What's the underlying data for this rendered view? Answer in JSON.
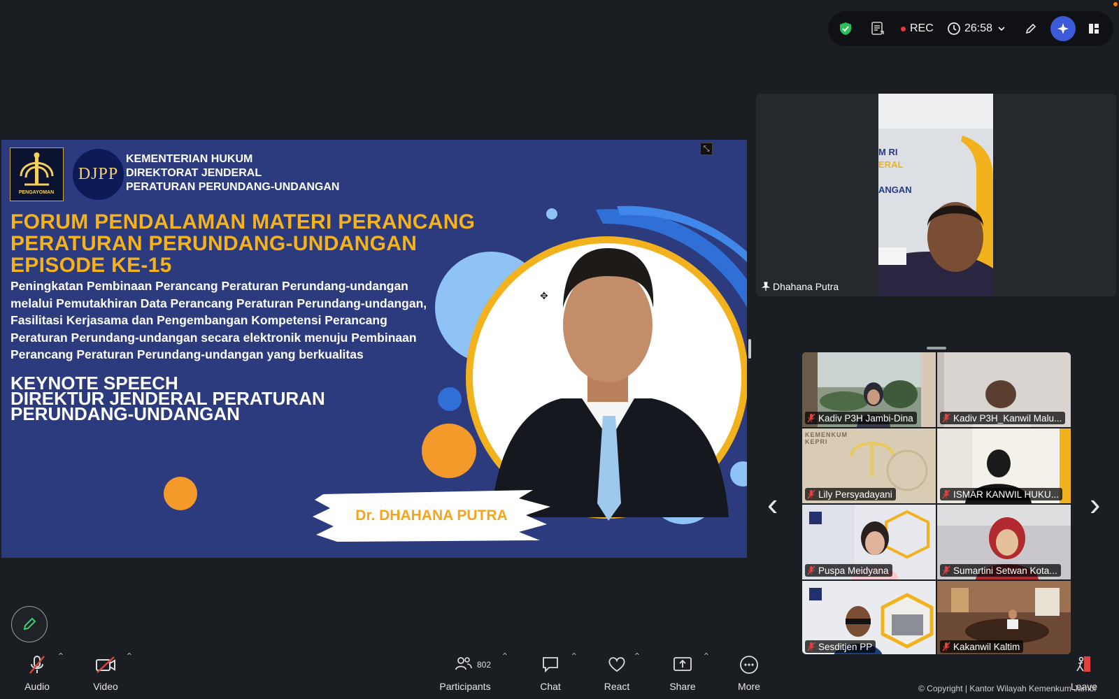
{
  "status_bar": {
    "rec_label": "REC",
    "timer": "26:58",
    "icons": [
      "security-shield-icon",
      "transcript-icon",
      "clock-icon",
      "chevron-down-icon",
      "pencil-icon",
      "ai-sparkle-icon",
      "panel-layout-icon"
    ]
  },
  "slide": {
    "logo_caption": "PENGAYOMAN",
    "djpp_text": "DJPP",
    "institution_line1": "KEMENTERIAN HUKUM",
    "institution_line2": "DIREKTORAT JENDERAL",
    "institution_line3": "PERATURAN PERUNDANG-UNDANGAN",
    "forum_title_line1": "FORUM PENDALAMAN MATERI PERANCANG",
    "forum_title_line2": "PERATURAN PERUNDANG-UNDANGAN",
    "forum_title_line3": "EPISODE KE-15",
    "subtitle_line1": "Peningkatan Pembinaan Perancang Peraturan Perundang-undangan",
    "subtitle_line2": "melalui Pemutakhiran Data Perancang Peraturan Perundang-undangan,",
    "subtitle_line3": "Fasilitasi Kerjasama dan Pengembangan Kompetensi Perancang",
    "subtitle_line4": "Peraturan Perundang-undangan secara elektronik menuju Pembinaan",
    "subtitle_line5": "Perancang Peraturan Perundang-undangan yang berkualitas",
    "keynote_line1": "KEYNOTE SPEECH",
    "keynote_line2": "DIREKTUR JENDERAL PERATURAN",
    "keynote_line3": "PERUNDANG-UNDANGAN",
    "speaker_label": "Dr. DHAHANA PUTRA",
    "colors": {
      "background": "#2c3a7e",
      "title": "#f5b21b",
      "accent_orange": "#f39a2a",
      "accent_blue": "#8fc3f5"
    }
  },
  "speaker_view": {
    "name": "Dhahana Putra",
    "backdrop_text_1": "M RI",
    "backdrop_text_2": "ERAL",
    "backdrop_text_3": "ANGAN"
  },
  "gallery": {
    "tiles": [
      {
        "name": "Kadiv P3H Jambi-Dina"
      },
      {
        "name": "Kadiv P3H_Kanwil Malu..."
      },
      {
        "name": "Lily Persyadayani",
        "backdrop_text": "KEMENKUM KEPRI"
      },
      {
        "name": "ISMAR KANWIL  HUKU..."
      },
      {
        "name": "Puspa Meidyana"
      },
      {
        "name": "Sumartini Setwan Kota..."
      },
      {
        "name": "Sesditjen PP"
      },
      {
        "name": "Kakanwil Kaltim"
      }
    ]
  },
  "toolbar": {
    "audio_label": "Audio",
    "video_label": "Video",
    "participants_label": "Participants",
    "participants_count": "802",
    "chat_label": "Chat",
    "react_label": "React",
    "share_label": "Share",
    "more_label": "More",
    "leave_label": "Leave"
  },
  "footer": {
    "copyright": "© Copyright | Kantor Wilayah Kemenkum Jambi"
  }
}
